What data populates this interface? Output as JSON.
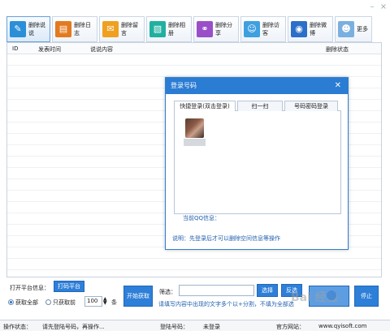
{
  "toolbar": {
    "items": [
      {
        "label": "删除说说",
        "icon": "speech-bubble-icon",
        "color": "#2b8fd8",
        "glyph": "✎"
      },
      {
        "label": "删除日志",
        "icon": "journal-icon",
        "color": "#e37a1f",
        "glyph": "▤"
      },
      {
        "label": "删除留言",
        "icon": "message-board-icon",
        "color": "#f0a020",
        "glyph": "✉"
      },
      {
        "label": "删除相册",
        "icon": "photo-album-icon",
        "color": "#20b0a0",
        "glyph": "▧"
      },
      {
        "label": "删除分享",
        "icon": "share-icon",
        "color": "#9a4fc8",
        "glyph": "⚭"
      },
      {
        "label": "删除访客",
        "icon": "visitor-icon",
        "color": "#3fa0e0",
        "glyph": "☺"
      },
      {
        "label": "删除微博",
        "icon": "weibo-icon",
        "color": "#2b6fc8",
        "glyph": "◉"
      },
      {
        "label": "更多",
        "icon": "more-icon",
        "color": "#7ab0e0",
        "glyph": "☻"
      }
    ]
  },
  "list": {
    "columns": [
      "ID",
      "发表时间",
      "说说内容",
      "删除状态"
    ]
  },
  "controls": {
    "platform_label": "打开平台信息：",
    "platform_button": "打码平台",
    "radio_all": "获取全部",
    "radio_recent": "只获取前",
    "count_value": "100",
    "count_unit": "条",
    "start_button": "开始获取",
    "filter_label": "筛选：",
    "select_button": "选择",
    "invert_button": "反选",
    "stop_button": "停止",
    "hint_text": "请填写内容中出现的文字多个以+分割，不填为全部选"
  },
  "dialog": {
    "title": "登录号码",
    "tabs": [
      "快捷登录(双击登录)",
      "扫一扫",
      "号码密码登录"
    ],
    "current_qq_label": "当前QQ信息：",
    "note": "说明：先登录后才可以删除空间信息等操作"
  },
  "statusbar": {
    "op_label": "操作状态：",
    "op_value": "请先登陆号码，再操作...",
    "account_label": "登陆号码：",
    "account_value": "未登录",
    "site_label": "官方网站：",
    "site_value": "www.qyisoft.com"
  },
  "watermark": "Bai 经验"
}
